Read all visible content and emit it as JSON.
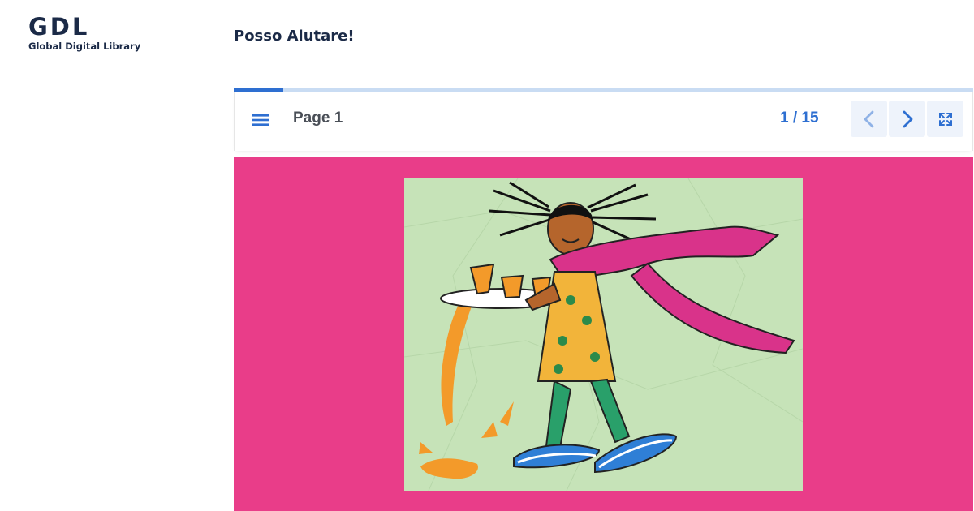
{
  "logo": {
    "mark": "GDL",
    "subtitle": "Global Digital Library"
  },
  "book": {
    "title": "Posso Aiutare!"
  },
  "reader": {
    "page_label": "Page 1",
    "page_counter": "1 / 15",
    "current_page": 1,
    "total_pages": 15,
    "progress_fraction": 0.067,
    "icons": {
      "menu": "menu-icon",
      "previous": "chevron-left-icon",
      "next": "chevron-right-icon",
      "fullscreen": "fullscreen-icon"
    }
  },
  "colors": {
    "accent": "#2e6fd1",
    "page_background": "#e93d89",
    "progress_track": "#c9dcf3",
    "title_text": "#1b2a47"
  },
  "illustration": {
    "subject": "girl-spilling-drinks-tray-illustration"
  }
}
